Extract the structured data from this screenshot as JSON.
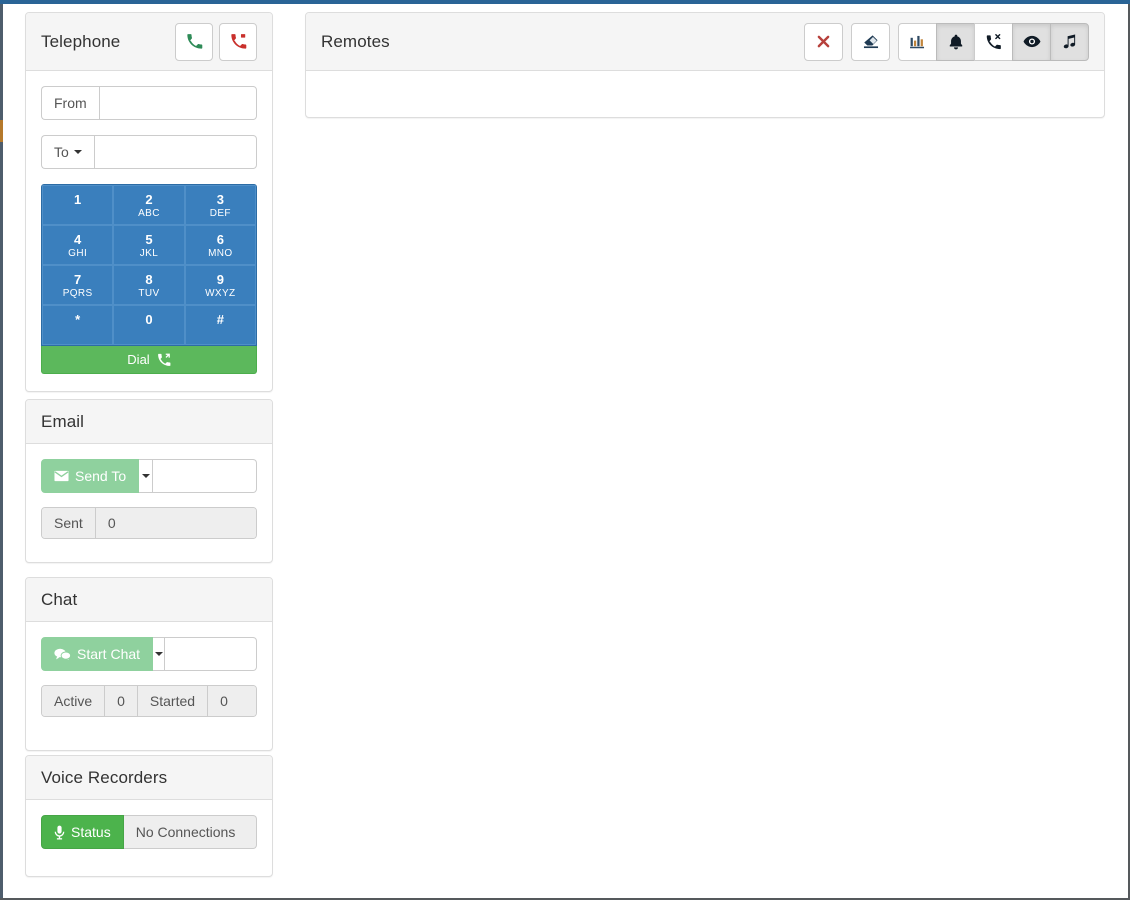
{
  "theme": {
    "top_bar_color": "#2a6496",
    "primary_blue": "#3a7fbd",
    "success_green": "#4cb34c",
    "muted_green": "#8fd19e",
    "panel_header_bg": "#f5f5f5",
    "border_gray": "#dddddd"
  },
  "telephone": {
    "title": "Telephone",
    "header_buttons": [
      {
        "name": "answer-call-button",
        "icon": "phone-icon",
        "color": "#2e8b57"
      },
      {
        "name": "hangup-call-button",
        "icon": "phone-hangup-icon",
        "color": "#c9302c"
      }
    ],
    "from": {
      "label": "From",
      "value": "",
      "placeholder": ""
    },
    "to": {
      "label": "To",
      "value": "",
      "placeholder": ""
    },
    "keypad": [
      {
        "digit": "1",
        "letters": ""
      },
      {
        "digit": "2",
        "letters": "ABC"
      },
      {
        "digit": "3",
        "letters": "DEF"
      },
      {
        "digit": "4",
        "letters": "GHI"
      },
      {
        "digit": "5",
        "letters": "JKL"
      },
      {
        "digit": "6",
        "letters": "MNO"
      },
      {
        "digit": "7",
        "letters": "PQRS"
      },
      {
        "digit": "8",
        "letters": "TUV"
      },
      {
        "digit": "9",
        "letters": "WXYZ"
      },
      {
        "digit": "*",
        "letters": ""
      },
      {
        "digit": "0",
        "letters": ""
      },
      {
        "digit": "#",
        "letters": ""
      }
    ],
    "dial_label": "Dial",
    "dial_icon": "phone-outgoing-icon"
  },
  "email": {
    "title": "Email",
    "send_to_label": "Send To",
    "send_to_icon": "envelope-icon",
    "send_to_enabled": false,
    "dropdown_icon": "caret-down-icon",
    "recipient_value": "",
    "recipient_placeholder": "",
    "sent_label": "Sent",
    "sent_count": "0"
  },
  "chat": {
    "title": "Chat",
    "start_chat_label": "Start Chat",
    "start_chat_icon": "comments-icon",
    "start_chat_enabled": false,
    "dropdown_icon": "caret-down-icon",
    "recipient_value": "",
    "recipient_placeholder": "",
    "active_label": "Active",
    "active_count": "0",
    "started_label": "Started",
    "started_count": "0"
  },
  "voice_recorders": {
    "title": "Voice Recorders",
    "status_label": "Status",
    "status_icon": "microphone-icon",
    "status_value": "No Connections"
  },
  "remotes": {
    "title": "Remotes",
    "toolbar": [
      {
        "name": "close-remote-button",
        "icon": "times-icon",
        "active": false,
        "group": 1
      },
      {
        "name": "clear-remote-button",
        "icon": "eraser-icon",
        "active": false,
        "group": 1
      },
      {
        "name": "statistics-button",
        "icon": "bar-chart-icon",
        "active": false,
        "group": 2
      },
      {
        "name": "alerts-button",
        "icon": "bell-icon",
        "active": true,
        "group": 2
      },
      {
        "name": "missed-calls-button",
        "icon": "phone-missed-icon",
        "active": false,
        "group": 2
      },
      {
        "name": "monitor-button",
        "icon": "eye-icon",
        "active": true,
        "group": 2
      },
      {
        "name": "music-on-hold-button",
        "icon": "music-icon",
        "active": true,
        "group": 2
      }
    ],
    "body_content": ""
  }
}
